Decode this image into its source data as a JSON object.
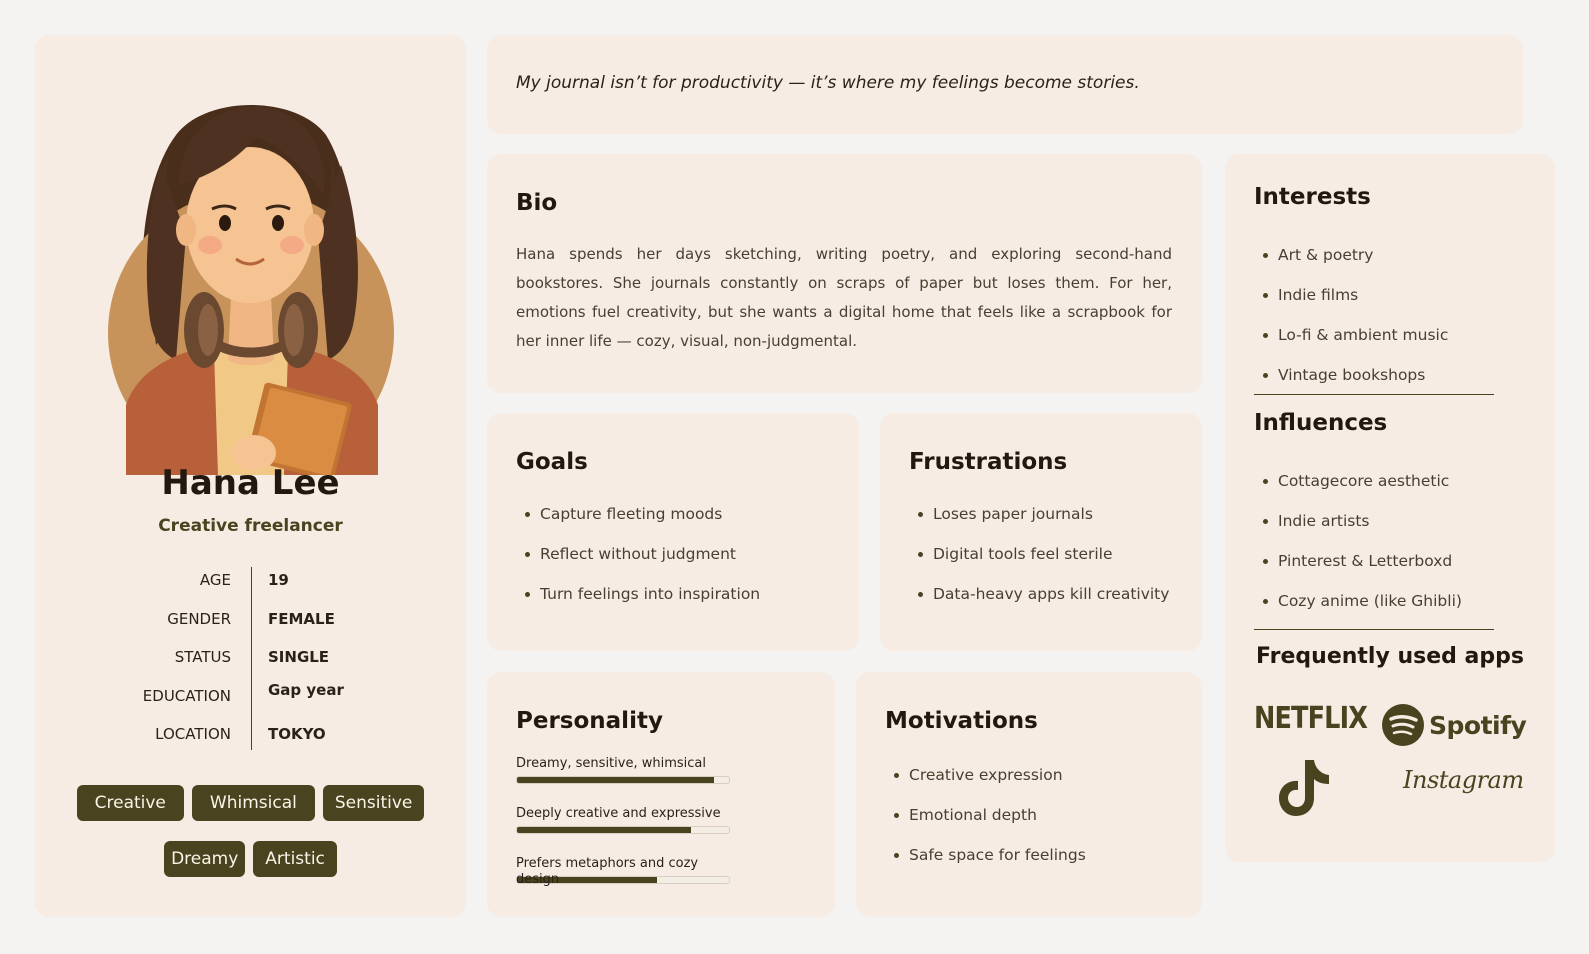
{
  "profile": {
    "name": "Hana Lee",
    "role": "Creative freelancer",
    "facts": [
      {
        "label": "AGE",
        "value": "19"
      },
      {
        "label": "GENDER",
        "value": "FEMALE"
      },
      {
        "label": "STATUS",
        "value": "SINGLE"
      },
      {
        "label": "EDUCATION",
        "value": "Gap year"
      },
      {
        "label": "LOCATION",
        "value": "TOKYO"
      }
    ],
    "tags": [
      "Creative",
      "Whimsical",
      "Sensitive",
      "Dreamy",
      "Artistic"
    ]
  },
  "quote": "My journal isn’t for productivity — it’s where my feelings become stories.",
  "bio": {
    "title": "Bio",
    "text": "Hana spends her days sketching, writing poetry, and exploring second-hand bookstores. She journals constantly on scraps of paper but loses them. For her, emotions fuel creativity, but she wants a digital home that feels like a scrapbook for her inner life — cozy, visual, non-judgmental."
  },
  "goals": {
    "title": "Goals",
    "items": [
      "Capture fleeting moods",
      "Reflect without judgment",
      "Turn feelings into inspiration"
    ]
  },
  "frustrations": {
    "title": "Frustrations",
    "items": [
      "Loses paper journals",
      "Digital tools feel sterile",
      "Data-heavy apps kill creativity"
    ]
  },
  "personality": {
    "title": "Personality",
    "traits": [
      {
        "label": "Dreamy, sensitive, whimsical",
        "level": 0.93
      },
      {
        "label": "Deeply creative and expressive",
        "level": 0.82
      },
      {
        "label": "Prefers metaphors and cozy design",
        "level": 0.66
      }
    ]
  },
  "motivations": {
    "title": "Motivations",
    "items": [
      "Creative expression",
      "Emotional depth",
      "Safe space for feelings"
    ]
  },
  "interests": {
    "title": "Interests",
    "items": [
      "Art & poetry",
      "Indie films",
      "Lo-fi & ambient music",
      "Vintage bookshops"
    ]
  },
  "influences": {
    "title": "Influences",
    "items": [
      "Cottagecore aesthetic",
      "Indie artists",
      "Pinterest & Letterboxd",
      "Cozy anime (like Ghibli)"
    ]
  },
  "apps": {
    "title": "Frequently used apps",
    "netflix": "NETFLIX",
    "spotify": "Spotify",
    "instagram": "Instagram",
    "icons": [
      "netflix-logo",
      "spotify-logo",
      "tiktok-logo",
      "instagram-logo"
    ]
  },
  "colors": {
    "background": "#f4f3f2",
    "card": "#f7ece3",
    "accent": "#4a4320",
    "text": "#23180f"
  }
}
